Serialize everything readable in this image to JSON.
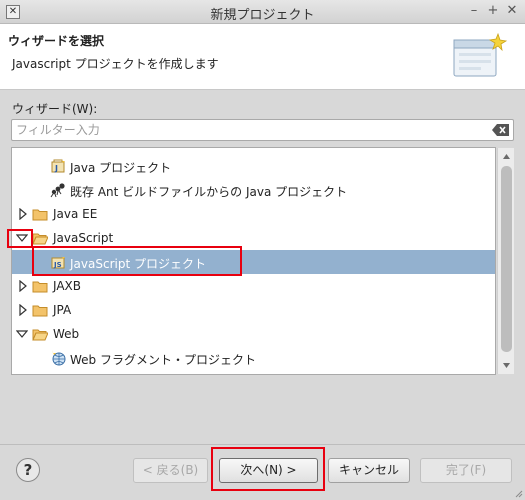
{
  "window": {
    "title": "新規プロジェクト",
    "icon_glyph": "✕",
    "minimize_glyph": "–",
    "maximize_glyph": "+",
    "close_glyph": "✕"
  },
  "header": {
    "title": "ウィザードを選択",
    "description": "Javascript プロジェクトを作成します",
    "banner_icon": "new-project-wizard-banner-icon"
  },
  "wizards_label": "ウィザード(W):",
  "filter": {
    "value": "",
    "placeholder": "フィルター入力",
    "clear_icon": "clear-filter-icon"
  },
  "tree": {
    "items": [
      {
        "label": "Java プロジェクト",
        "icon": "java-project-icon",
        "expandable": false,
        "expanded": false,
        "selected": false
      },
      {
        "label": "既存 Ant ビルドファイルからの Java プロジェクト",
        "icon": "ant-java-project-icon",
        "expandable": false,
        "expanded": false,
        "selected": false
      },
      {
        "label": "Java EE",
        "icon": "folder-icon",
        "expandable": true,
        "expanded": false,
        "selected": false
      },
      {
        "label": "JavaScript",
        "icon": "folder-icon",
        "expandable": true,
        "expanded": true,
        "selected": false
      },
      {
        "label": "JavaScript プロジェクト",
        "icon": "javascript-project-icon",
        "expandable": false,
        "expanded": false,
        "selected": true
      },
      {
        "label": "JAXB",
        "icon": "folder-icon",
        "expandable": true,
        "expanded": false,
        "selected": false
      },
      {
        "label": "JPA",
        "icon": "folder-icon",
        "expandable": true,
        "expanded": false,
        "selected": false
      },
      {
        "label": "Web",
        "icon": "folder-icon",
        "expandable": true,
        "expanded": true,
        "selected": false
      },
      {
        "label": "Web フラグメント・プロジェクト",
        "icon": "web-fragment-project-icon",
        "expandable": false,
        "expanded": false,
        "selected": false
      }
    ]
  },
  "buttons": {
    "help": "?",
    "back": "< 戻る(B)",
    "next": "次へ(N) >",
    "cancel": "キャンセル",
    "finish": "完了(F)"
  },
  "colors": {
    "highlight": "#e8000f",
    "selection": "#93b1cf"
  }
}
